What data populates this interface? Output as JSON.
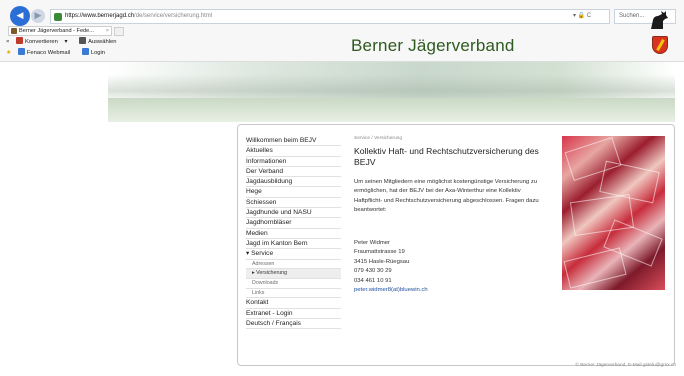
{
  "browser": {
    "url_host": "https://www.bernerjagd.ch",
    "url_path": "/de/service/versicherung.html",
    "search_placeholder": "Suchen...",
    "address_icons": "▾ 🔒 C",
    "tab_title": "Berner Jägerverband - Fede...",
    "tab_close": "×",
    "toolbar1": {
      "close": "×",
      "convert": "Konvertieren",
      "convert_arrow": "▾",
      "select": "Auswählen"
    },
    "toolbar2": {
      "webmail": "Fenaco Webmail",
      "login": "Login"
    }
  },
  "site": {
    "title": "Berner  Jägerverband"
  },
  "menu": {
    "items": [
      {
        "label": "Willkommen beim BEJV",
        "type": "main"
      },
      {
        "label": "Aktuelles",
        "type": "main"
      },
      {
        "label": "Informationen",
        "type": "main"
      },
      {
        "label": "Der Verband",
        "type": "main"
      },
      {
        "label": "Jagdausbildung",
        "type": "main"
      },
      {
        "label": "Hege",
        "type": "main"
      },
      {
        "label": "Schiessen",
        "type": "main"
      },
      {
        "label": "Jagdhunde und NASU",
        "type": "main"
      },
      {
        "label": "Jagdhornbläser",
        "type": "main"
      },
      {
        "label": "Medien",
        "type": "main"
      },
      {
        "label": "Jagd im Kanton Bern",
        "type": "main"
      },
      {
        "label": "▾ Service",
        "type": "main"
      },
      {
        "label": "Adressen",
        "type": "sub"
      },
      {
        "label": "▸ Versicherung",
        "type": "sub",
        "active": true
      },
      {
        "label": "Downloads",
        "type": "sub"
      },
      {
        "label": "Links",
        "type": "sub"
      },
      {
        "label": "Kontakt",
        "type": "main"
      },
      {
        "label": "Extranet - Login",
        "type": "main"
      },
      {
        "label": "Deutsch / Français",
        "type": "main"
      }
    ]
  },
  "main": {
    "breadcrumb": "Service / Versicherung",
    "title": "Kollektiv Haft- und Rechtschutzversicherung des BEJV",
    "intro": "Um seinen Mitgliedern eine möglichst kostengünstige Versicherung zu ermöglichen, hat der BEJV bei der Axa-Winterthur eine Kollektiv Haftpflicht- und Rechtschutzversicherung abgeschlossen. Fragen dazu beantwortet:",
    "contact": {
      "name": "Peter Widmer",
      "street": "Fraumattstrasse 19",
      "city": "3415 Hasle-Rüegsau",
      "phone1": "079 430 30 29",
      "phone2": "034 461 10 91",
      "email": "peter.widmer8(at)bluewin.ch"
    }
  },
  "footer": {
    "copyright": "© Berner Jägerverband, E-Mail gstelu@gmx.ch"
  },
  "colors": {
    "title_green": "#2d5a1f",
    "link_blue": "#1f4e9e",
    "browser_blue": "#2b6fd6"
  }
}
